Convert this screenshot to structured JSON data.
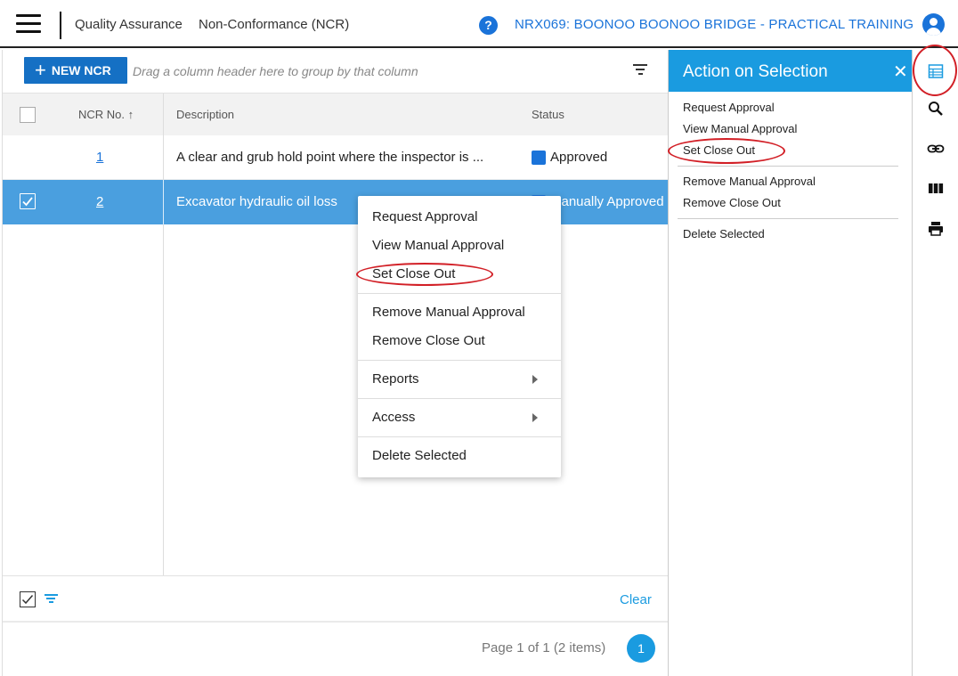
{
  "header": {
    "breadcrumb_module": "Quality Assurance",
    "breadcrumb_page": "Non-Conformance (NCR)",
    "help_label": "?",
    "project": "NRX069: BOONOO BOONOO BRIDGE - PRACTICAL TRAINING"
  },
  "toolbar": {
    "new_label": "NEW NCR",
    "group_hint": "Drag a column header here to group by that column"
  },
  "columns": {
    "ncr_no": "NCR No. ↑",
    "description": "Description",
    "status": "Status"
  },
  "rows": [
    {
      "no": "1",
      "description": "A clear and grub hold point where the inspector is ...",
      "status": "Approved",
      "selected": false
    },
    {
      "no": "2",
      "description": "Excavator hydraulic oil loss",
      "status": "Manually Approved",
      "selected": true
    }
  ],
  "footer": {
    "clear_label": "Clear",
    "page_info": "Page 1 of 1 (2 items)",
    "page_number": "1"
  },
  "context_menu": {
    "request_approval": "Request Approval",
    "view_manual_approval": "View Manual Approval",
    "set_close_out": "Set Close Out",
    "remove_manual_approval": "Remove Manual Approval",
    "remove_close_out": "Remove Close Out",
    "reports": "Reports",
    "access": "Access",
    "delete_selected": "Delete Selected"
  },
  "panel": {
    "title": "Action on Selection",
    "close_glyph": "✕",
    "request_approval": "Request Approval",
    "view_manual_approval": "View Manual Approval",
    "set_close_out": "Set Close Out",
    "remove_manual_approval": "Remove Manual Approval",
    "remove_close_out": "Remove Close Out",
    "delete_selected": "Delete Selected"
  },
  "rail_icons": [
    "list-view-icon",
    "search-icon",
    "link-icon",
    "columns-icon",
    "print-icon"
  ],
  "colors": {
    "accent": "#1a9be0",
    "brand_blue": "#1570c4",
    "selected_row": "#4a9fdf",
    "annotation_red": "#d21f26"
  }
}
